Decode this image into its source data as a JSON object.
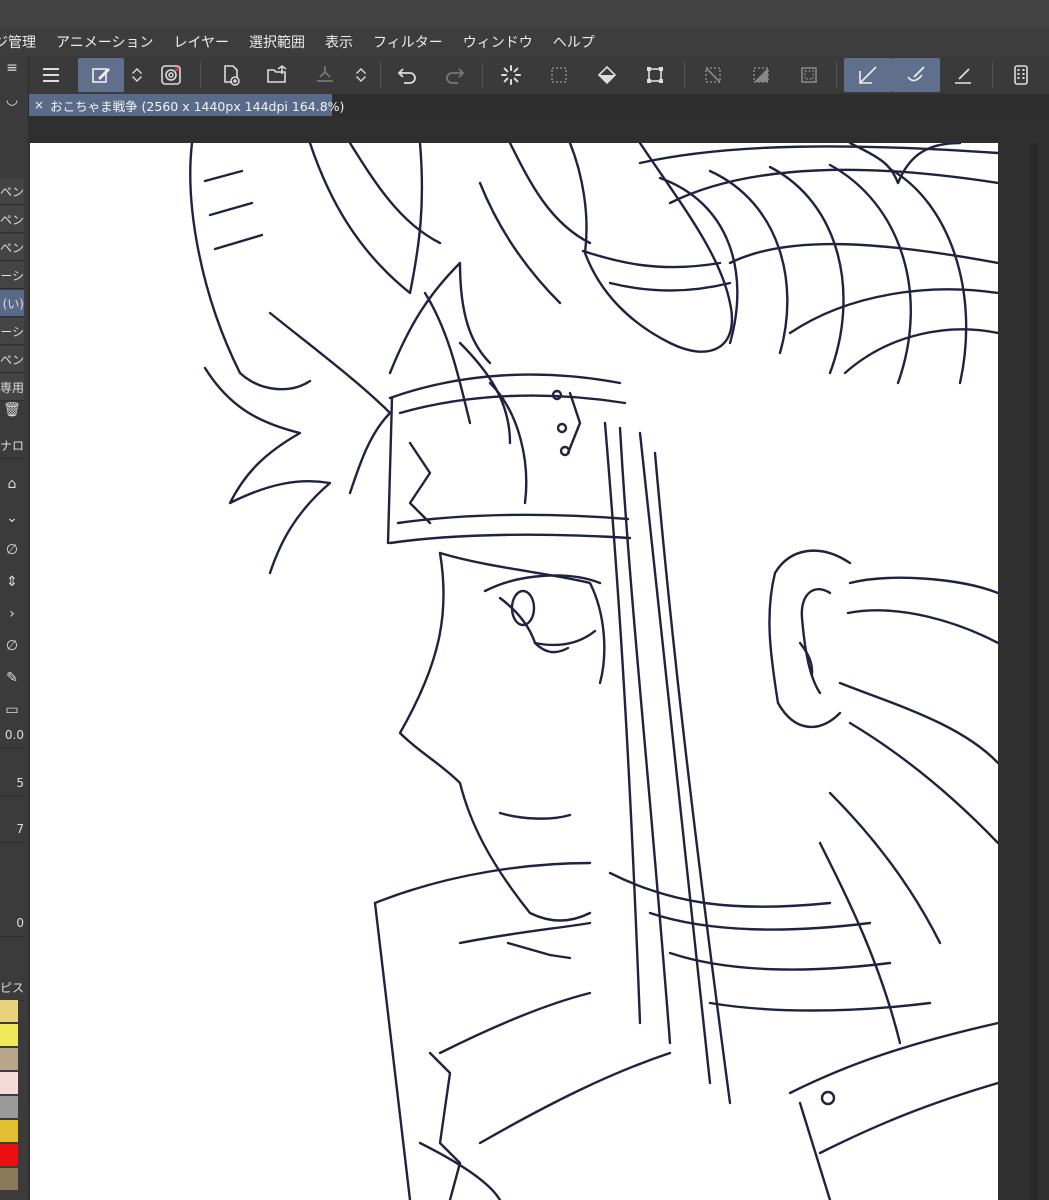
{
  "menu": [
    "ジ管理",
    "アニメーション",
    "レイヤー",
    "選択範囲",
    "表示",
    "フィルター",
    "ウィンドウ",
    "ヘルプ"
  ],
  "toolbar": {
    "icons": [
      "menu-icon",
      "pen-edit-icon",
      "up-down-icon",
      "spiral-icon",
      "new-page-icon",
      "open-folder-icon",
      "export-icon",
      "up-down-icon",
      "undo-icon",
      "redo-icon",
      "loading-icon",
      "select-dotted-icon",
      "fill-icon",
      "transform-icon",
      "no-selection-icon",
      "gradient-mask-icon",
      "select-frame-icon",
      "pen-pressure-icon",
      "brush-curve-icon",
      "ruler-pen-icon",
      "tablet-icon"
    ]
  },
  "document": {
    "tab_label": "おこちゃま戦争 (2560 x 1440px 144dpi 164.8%)",
    "close_glyph": "×"
  },
  "left_panel": {
    "tool_items": [
      "ペン",
      "ペン",
      "ペン",
      "ーシ",
      "(い)",
      "ーシ",
      "ペン",
      "専用"
    ],
    "selected_index": 4,
    "labels": {
      "brush_size": "0.0",
      "value_a": "5",
      "value_b": "7",
      "value_c": "0",
      "section": "ナロ",
      "palette": "ピス"
    },
    "swatches": [
      "#e8d27a",
      "#f0e85a",
      "#b8a58a",
      "#f6d9d9",
      "#9a9a9a",
      "#e0c030",
      "#e81010",
      "#8a7a5a"
    ]
  },
  "colors": {
    "accent": "#5f6f8c",
    "line_art": "#1f2340",
    "canvas": "#ffffff"
  }
}
